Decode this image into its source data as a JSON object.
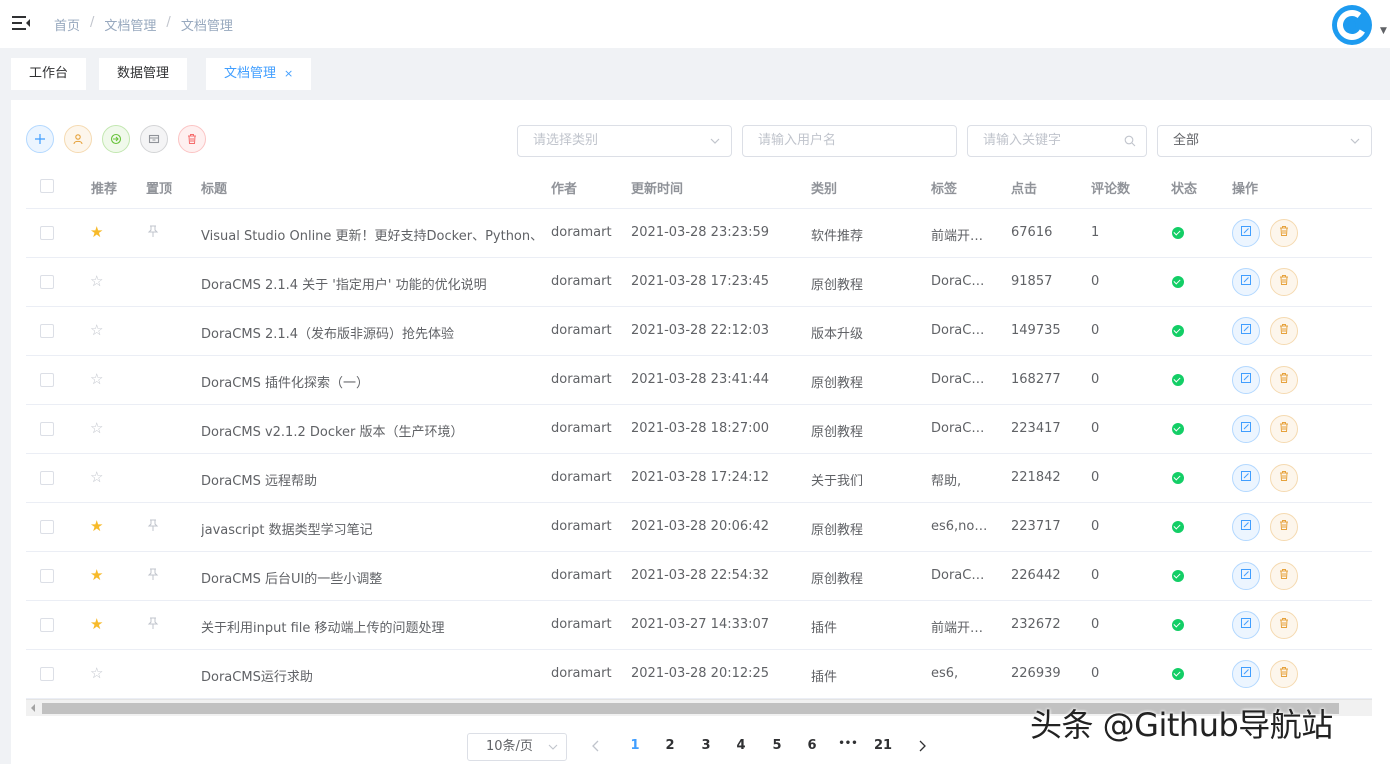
{
  "breadcrumb": [
    "首页",
    "文档管理",
    "文档管理"
  ],
  "tags": [
    {
      "label": "工作台"
    },
    {
      "label": "数据管理"
    },
    {
      "label": "文档管理",
      "close": "×"
    }
  ],
  "filters": {
    "category_placeholder": "请选择类别",
    "username_placeholder": "请输入用户名",
    "keyword_placeholder": "请输入关键字",
    "status_value": "全部"
  },
  "colors": {
    "primary": "#409eff",
    "success": "#13ce66",
    "warning": "#e6a23c",
    "danger": "#f56c6c",
    "star": "#f7ba2a"
  },
  "columns": [
    "推荐",
    "置顶",
    "标题",
    "作者",
    "更新时间",
    "类别",
    "标签",
    "点击",
    "评论数",
    "状态",
    "操作"
  ],
  "rows": [
    {
      "recommend": true,
      "top": true,
      "title": "Visual Studio Online 更新！更好支持Docker、Python、",
      "author": "doramart",
      "updated": "2021-03-28 23:23:59",
      "category": "软件推荐",
      "tags": "前端开…",
      "clicks": "67616",
      "comments": "1"
    },
    {
      "recommend": false,
      "top": false,
      "title": "DoraCMS 2.1.4 关于 '指定用户' 功能的优化说明",
      "author": "doramart",
      "updated": "2021-03-28 17:23:45",
      "category": "原创教程",
      "tags": "DoraC…",
      "clicks": "91857",
      "comments": "0"
    },
    {
      "recommend": false,
      "top": false,
      "title": "DoraCMS 2.1.4（发布版非源码）抢先体验",
      "author": "doramart",
      "updated": "2021-03-28 22:12:03",
      "category": "版本升级",
      "tags": "DoraC…",
      "clicks": "149735",
      "comments": "0"
    },
    {
      "recommend": false,
      "top": false,
      "title": "DoraCMS 插件化探索（一）",
      "author": "doramart",
      "updated": "2021-03-28 23:41:44",
      "category": "原创教程",
      "tags": "DoraC…",
      "clicks": "168277",
      "comments": "0"
    },
    {
      "recommend": false,
      "top": false,
      "title": "DoraCMS v2.1.2 Docker 版本（生产环境）",
      "author": "doramart",
      "updated": "2021-03-28 18:27:00",
      "category": "原创教程",
      "tags": "DoraC…",
      "clicks": "223417",
      "comments": "0"
    },
    {
      "recommend": false,
      "top": false,
      "title": "DoraCMS 远程帮助",
      "author": "doramart",
      "updated": "2021-03-28 17:24:12",
      "category": "关于我们",
      "tags": "帮助,",
      "clicks": "221842",
      "comments": "0"
    },
    {
      "recommend": true,
      "top": true,
      "title": "javascript 数据类型学习笔记",
      "author": "doramart",
      "updated": "2021-03-28 20:06:42",
      "category": "原创教程",
      "tags": "es6,no…",
      "clicks": "223717",
      "comments": "0"
    },
    {
      "recommend": true,
      "top": true,
      "title": "DoraCMS 后台UI的一些小调整",
      "author": "doramart",
      "updated": "2021-03-28 22:54:32",
      "category": "原创教程",
      "tags": "DoraC…",
      "clicks": "226442",
      "comments": "0"
    },
    {
      "recommend": true,
      "top": true,
      "title": "关于利用input file 移动端上传的问题处理",
      "author": "doramart",
      "updated": "2021-03-27 14:33:07",
      "category": "插件",
      "tags": "前端开…",
      "clicks": "232672",
      "comments": "0"
    },
    {
      "recommend": false,
      "top": false,
      "title": "DoraCMS运行求助",
      "author": "doramart",
      "updated": "2021-03-28 20:12:25",
      "category": "插件",
      "tags": "es6,",
      "clicks": "226939",
      "comments": "0"
    }
  ],
  "pagination": {
    "page_size": "10条/页",
    "pages": [
      "1",
      "2",
      "3",
      "4",
      "5",
      "6",
      "•••",
      "21"
    ],
    "current": "1"
  },
  "watermark": "头条 @Github导航站"
}
